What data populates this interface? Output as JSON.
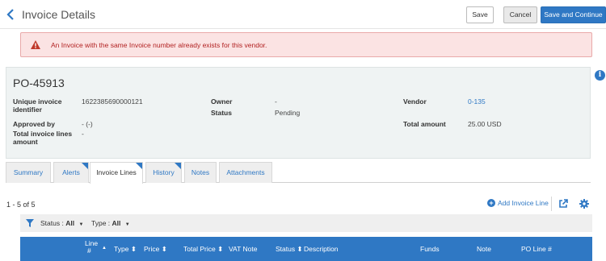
{
  "header": {
    "title": "Invoice Details",
    "save_label": "Save",
    "cancel_label": "Cancel",
    "save_continue_label": "Save and Continue"
  },
  "alert": {
    "message": "An Invoice with the same Invoice number already exists for this vendor.",
    "color": "#b22222"
  },
  "info": {
    "po_number": "PO-45913",
    "unique_identifier_label": "Unique invoice identifier",
    "unique_identifier_value": "1622385690000121",
    "approved_by_label": "Approved by",
    "approved_by_value": "- (-)",
    "total_lines_label": "Total invoice lines amount",
    "total_lines_value": "-",
    "owner_label": "Owner",
    "owner_value": "-",
    "status_label": "Status",
    "status_value": "Pending",
    "vendor_label": "Vendor",
    "vendor_value": "0-135",
    "total_amount_label": "Total amount",
    "total_amount_value": "25.00 USD"
  },
  "tabs": [
    {
      "label": "Summary",
      "active": false,
      "flag": false
    },
    {
      "label": "Alerts",
      "active": false,
      "flag": true
    },
    {
      "label": "Invoice Lines",
      "active": true,
      "flag": true
    },
    {
      "label": "History",
      "active": false,
      "flag": true
    },
    {
      "label": "Notes",
      "active": false,
      "flag": false
    },
    {
      "label": "Attachments",
      "active": false,
      "flag": false
    }
  ],
  "list": {
    "range": "1 - 5 of 5",
    "add_label": "Add Invoice Line"
  },
  "filters": {
    "status_label": "Status :",
    "status_value": "All",
    "type_label": "Type :",
    "type_value": "All"
  },
  "table": {
    "columns": {
      "line_top": "Line",
      "line_bottom": "#",
      "type": "Type",
      "price": "Price",
      "total_price": "Total Price",
      "vat_note": "VAT Note",
      "status": "Status",
      "description": "Description",
      "funds": "Funds",
      "note": "Note",
      "po_line": "PO Line #"
    },
    "sort_asc_glyph": "▲",
    "sort_glyph": "⬍"
  },
  "colors": {
    "accent": "#2f78c4",
    "alert_bg": "#fbe3e3",
    "panel_bg": "#eff3f3"
  },
  "icons": {
    "back": "chevron-left-icon",
    "alert": "warning-triangle-icon",
    "info": "info-circle-icon",
    "add": "plus-circle-icon",
    "external": "external-link-icon",
    "settings": "gear-icon",
    "filter": "funnel-icon"
  }
}
